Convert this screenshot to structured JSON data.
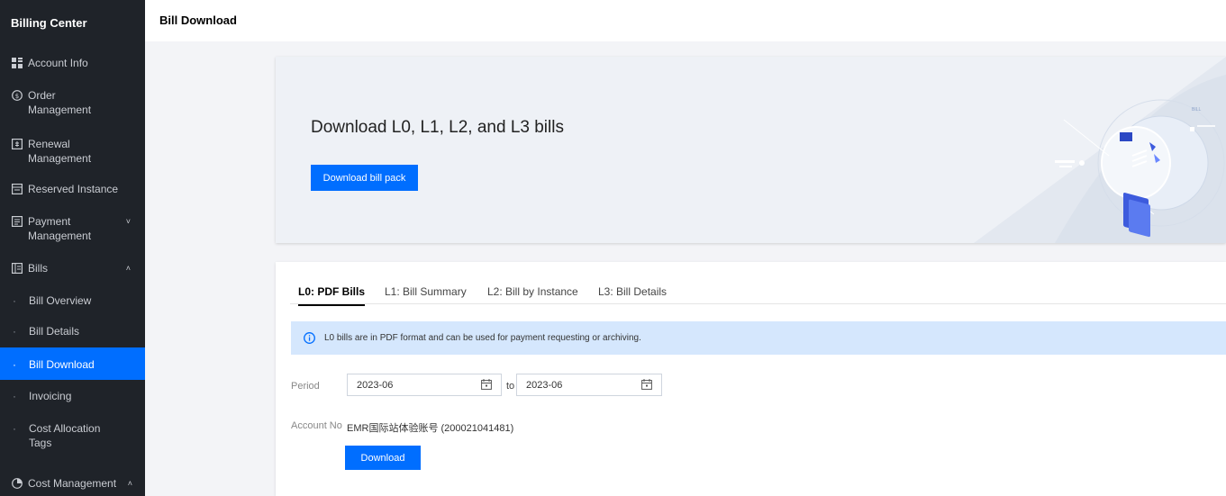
{
  "sidebar": {
    "title": "Billing Center",
    "items": [
      {
        "label": "Account Info",
        "icon": "grid-icon"
      },
      {
        "label": "Order\nManagement",
        "icon": "order-icon"
      },
      {
        "label": "Renewal\nManagement",
        "icon": "renewal-icon"
      },
      {
        "label": "Reserved Instance",
        "icon": "reserved-icon"
      },
      {
        "label": "Payment\nManagement",
        "icon": "payment-icon",
        "arrow": "˅"
      },
      {
        "label": "Bills",
        "icon": "bills-icon",
        "arrow": "˄"
      }
    ],
    "bills_sub": [
      {
        "label": "Bill Overview"
      },
      {
        "label": "Bill Details"
      },
      {
        "label": "Bill Download",
        "active": true
      },
      {
        "label": "Invoicing"
      },
      {
        "label": "Cost Allocation\nTags"
      }
    ],
    "cost_management": {
      "label": "Cost Management",
      "icon": "pie-chart-icon",
      "arrow": "˄"
    },
    "sub_dot": "·"
  },
  "header": {
    "title": "Bill Download"
  },
  "banner": {
    "heading": "Download L0, L1, L2, and L3 bills",
    "button": "Download bill pack",
    "illustration_label": "BILL"
  },
  "tabs": [
    {
      "label": "L0: PDF Bills",
      "active": true
    },
    {
      "label": "L1: Bill Summary"
    },
    {
      "label": "L2: Bill by Instance"
    },
    {
      "label": "L3: Bill Details"
    }
  ],
  "notice": {
    "text": "L0 bills are in PDF format and can be used for payment requesting or archiving."
  },
  "form": {
    "period_label": "Period",
    "start": "2023-06",
    "to_label": "to",
    "end": "2023-06",
    "account_label": "Account No",
    "account_value": "EMR国际站体验账号 (200021041481)",
    "download_button": "Download"
  },
  "colors": {
    "accent": "#006eff",
    "sidebar_bg": "#1f2329",
    "notice_bg": "#d5e7fd"
  }
}
